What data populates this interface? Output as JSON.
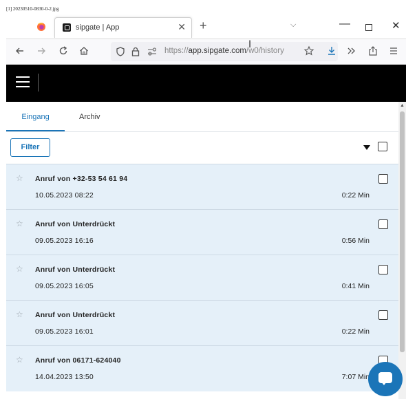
{
  "caption": "[1] 20230510-0830-0-2.jpg",
  "browser": {
    "tab_title": "sipgate | App",
    "tab_close": "✕",
    "new_tab": "+",
    "tab_list": "⌵",
    "window_min": "—",
    "window_close": "✕",
    "url_prefix": "https://",
    "url_host": "app.sipgate.com",
    "url_path": "/w0/history",
    "icons": [
      "firefox-icon",
      "back-icon",
      "forward-icon",
      "reload-icon",
      "home-icon",
      "shield-icon",
      "lock-icon",
      "permissions-icon",
      "bookmark-star-icon",
      "download-icon",
      "more-tools-icon",
      "share-icon",
      "menu-icon"
    ]
  },
  "app": {
    "tabs": [
      {
        "label": "Eingang",
        "active": true
      },
      {
        "label": "Archiv",
        "active": false
      }
    ],
    "filter_label": "Filter",
    "accent_color": "#1b75b8",
    "row_bg_color": "#e5f0f9"
  },
  "calls": [
    {
      "title": "Anruf von +32-53 54 61 94",
      "date": "10.05.2023 08:22",
      "duration": "0:22 Min"
    },
    {
      "title": "Anruf von Unterdrückt",
      "date": "09.05.2023 16:16",
      "duration": "0:56 Min"
    },
    {
      "title": "Anruf von Unterdrückt",
      "date": "09.05.2023 16:05",
      "duration": "0:41 Min"
    },
    {
      "title": "Anruf von Unterdrückt",
      "date": "09.05.2023 16:01",
      "duration": "0:22 Min"
    },
    {
      "title": "Anruf von 06171-624040",
      "date": "14.04.2023 13:50",
      "duration": "7:07 Min"
    }
  ]
}
